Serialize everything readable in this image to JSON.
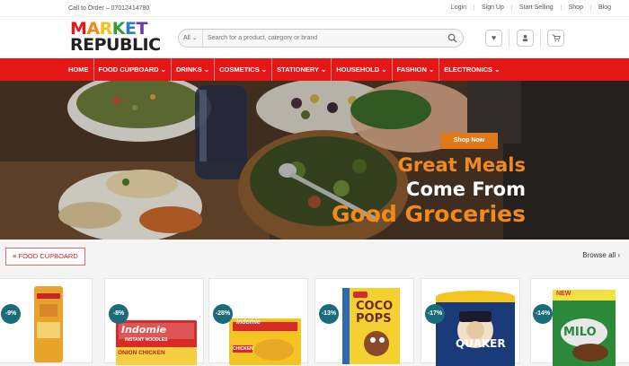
{
  "topbar": {
    "call_text": "Call to Order – 07012414780",
    "links": [
      "Login",
      "Sign Up",
      "Start Selling",
      "Shop",
      "Blog"
    ]
  },
  "header": {
    "logo_line1": "MARKET",
    "logo_line2": "REPUBLIC",
    "search_category": "All",
    "search_placeholder": "Search for a product, category or brand"
  },
  "nav": {
    "items": [
      "HOME",
      "FOOD CUPBOARD",
      "DRINKS",
      "COSMETICS",
      "STATIONERY",
      "HOUSEHOLD",
      "FASHION",
      "ELECTRONICS"
    ]
  },
  "hero": {
    "button": "Shop Now",
    "line1": "Great Meals",
    "line2": "Come From",
    "line3": "Good Groceries"
  },
  "section": {
    "title": "FOOD CUPBOARD",
    "browse": "Browse all"
  },
  "products": [
    {
      "discount": "-9%"
    },
    {
      "discount": "-8%",
      "label": "Indomie",
      "sub": "INSTANT NOODLES",
      "extra": "ONION CHICKEN"
    },
    {
      "discount": "-28%",
      "label": "Indomie",
      "sub": "CHICKEN"
    },
    {
      "discount": "-13%",
      "label": "COCO",
      "sub": "POPS"
    },
    {
      "discount": "-17%",
      "label": "QUAKER"
    },
    {
      "discount": "-14%",
      "label": "MILO",
      "sub": "NEW"
    }
  ],
  "colors": {
    "brand_red": "#e51616",
    "accent_orange": "#f08a1c",
    "badge_teal": "#1b6b7a"
  }
}
